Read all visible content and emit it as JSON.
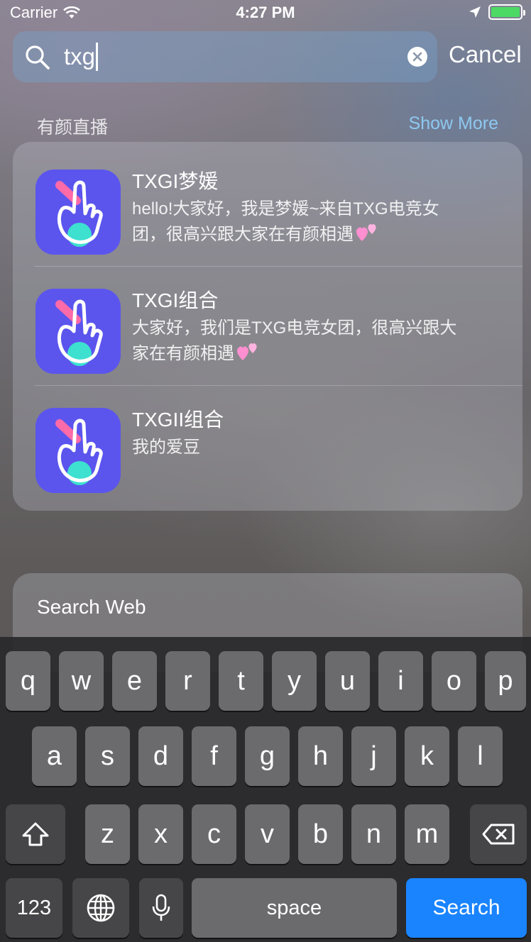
{
  "status_bar": {
    "carrier": "Carrier",
    "time": "4:27 PM",
    "battery_level": 1.0,
    "battery_color": "#4cd964"
  },
  "search": {
    "query": "txg",
    "cancel_label": "Cancel"
  },
  "section": {
    "title": "有颜直播",
    "show_more": "Show More"
  },
  "results": [
    {
      "title": "TXGI梦媛",
      "line1": "hello!大家好，我是梦媛~来自TXG电竞女",
      "line2": "团，很高兴跟大家在有颜相遇",
      "icon": "hand-heart-app-icon"
    },
    {
      "title": "TXGI组合",
      "line1": "大家好，我们是TXG电竞女团，很高兴跟大",
      "line2": "家在有颜相遇",
      "icon": "hand-heart-app-icon"
    },
    {
      "title": "TXGII组合",
      "line1": "我的爱豆",
      "line2": "",
      "icon": "hand-heart-app-icon"
    }
  ],
  "search_web": {
    "label": "Search Web"
  },
  "keyboard": {
    "row1": [
      "q",
      "w",
      "e",
      "r",
      "t",
      "y",
      "u",
      "i",
      "o",
      "p"
    ],
    "row2": [
      "a",
      "s",
      "d",
      "f",
      "g",
      "h",
      "j",
      "k",
      "l"
    ],
    "row3": [
      "z",
      "x",
      "c",
      "v",
      "b",
      "n",
      "m"
    ],
    "numbers_label": "123",
    "space_label": "space",
    "return_label": "Search"
  },
  "colors": {
    "accent": "#1a84ff",
    "show_more": "#8ec8f0",
    "app_icon_bg": "#5b55ee"
  }
}
